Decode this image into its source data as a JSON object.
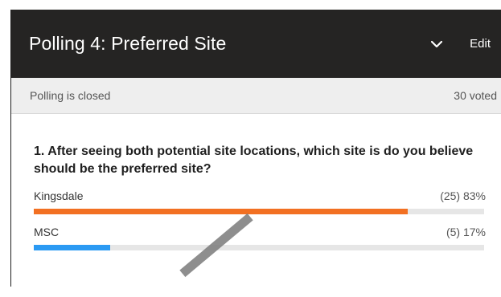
{
  "header": {
    "title": "Polling 4: Preferred Site",
    "edit_label": "Edit"
  },
  "status": {
    "state_text": "Polling is closed",
    "voted_text": "30 voted"
  },
  "question": {
    "text": "1. After seeing both potential site locations, which site is do you believe should be the preferred site?"
  },
  "options": [
    {
      "label": "Kingsdale",
      "result": "(25) 83%",
      "fraction": 0.83,
      "color": "#f27022"
    },
    {
      "label": "MSC",
      "result": "(5) 17%",
      "fraction": 0.17,
      "color": "#2b9af3"
    }
  ],
  "icons": {
    "collapse": "chevron-down-icon"
  }
}
